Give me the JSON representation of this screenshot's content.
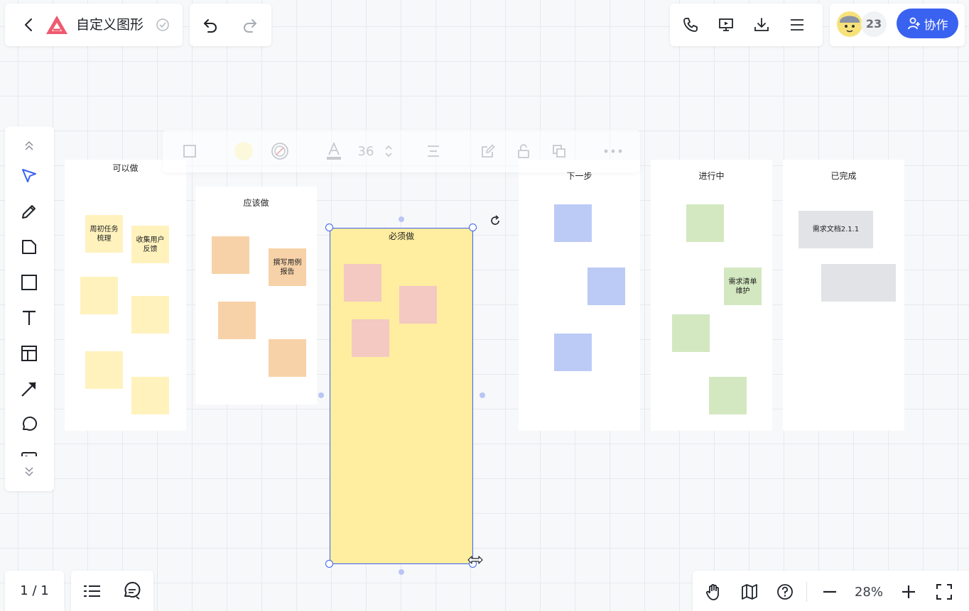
{
  "header": {
    "title": "自定义图形"
  },
  "collab": {
    "avatar_count": "23",
    "button_label": "协作"
  },
  "left_toolbar": {
    "tools": [
      "select-tool",
      "pen-tool",
      "sticky-note-tool",
      "rectangle-tool",
      "text-tool",
      "template-tool",
      "arrow-tool",
      "comment-tool",
      "image-tool"
    ]
  },
  "context_toolbar": {
    "font_size": "36",
    "fill_color": "#fcf8dc"
  },
  "board": {
    "columns": [
      {
        "title": "可以做",
        "notes": [
          "周初任务梳理",
          "收集用户反馈"
        ]
      },
      {
        "title": "应该做",
        "notes": [
          "撰写用例报告"
        ]
      },
      {
        "title": "必须做"
      },
      {
        "title": "下一步"
      },
      {
        "title": "进行中",
        "notes": [
          "需求清单维护"
        ]
      },
      {
        "title": "已完成",
        "notes": [
          "需求文档2.1.1"
        ]
      }
    ]
  },
  "colors": {
    "accent": "#3a62f0",
    "selected_fill": "#ffeda0",
    "sticky_yellow": "#fff2bd",
    "sticky_orange": "#f7d2a8",
    "sticky_pink": "#f3c9c2",
    "sticky_blue": "#bccbf5",
    "sticky_green": "#d3e8c0",
    "sticky_gray": "#e1e3e7"
  },
  "footer": {
    "page_indicator": "1 / 1",
    "zoom": "28%"
  }
}
